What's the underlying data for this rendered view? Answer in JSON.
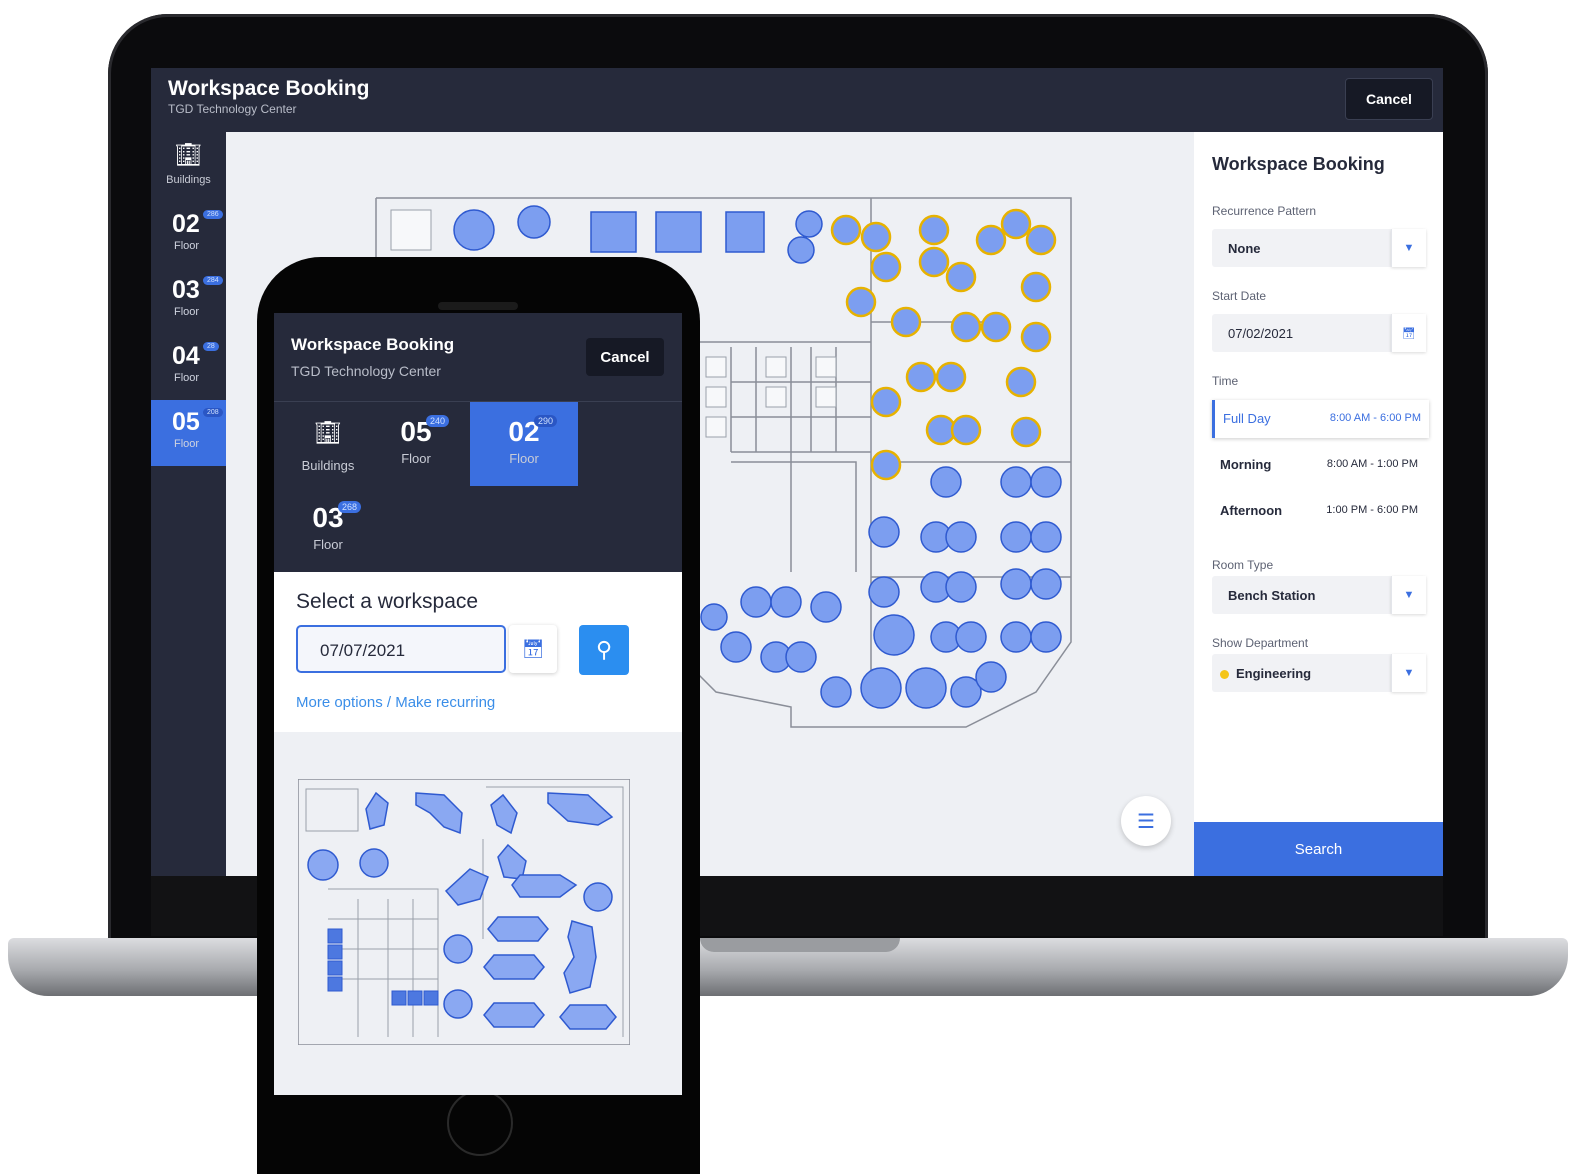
{
  "desktop": {
    "header": {
      "title": "Workspace Booking",
      "subtitle": "TGD Technology Center",
      "cancel_label": "Cancel"
    },
    "sidebar": {
      "buildings_label": "Buildings",
      "floors": [
        {
          "number": "02",
          "label": "Floor",
          "count": "286",
          "active": false
        },
        {
          "number": "03",
          "label": "Floor",
          "count": "284",
          "active": false
        },
        {
          "number": "04",
          "label": "Floor",
          "count": "28",
          "active": false
        },
        {
          "number": "05",
          "label": "Floor",
          "count": "208",
          "active": true
        }
      ]
    },
    "panel": {
      "title": "Workspace Booking",
      "recurrence_label": "Recurrence Pattern",
      "recurrence_value": "None",
      "start_date_label": "Start Date",
      "start_date_value": "07/02/2021",
      "time_label": "Time",
      "time_options": [
        {
          "name": "Full Day",
          "range": "8:00 AM - 6:00 PM",
          "selected": true
        },
        {
          "name": "Morning",
          "range": "8:00 AM - 1:00 PM",
          "selected": false
        },
        {
          "name": "Afternoon",
          "range": "1:00 PM - 6:00 PM",
          "selected": false
        }
      ],
      "room_type_label": "Room Type",
      "room_type_value": "Bench Station",
      "department_label": "Show Department",
      "department_value": "Engineering",
      "search_label": "Search"
    },
    "colors": {
      "accent": "#3b6fe0",
      "header": "#262a3b",
      "highlight": "#f5c518"
    }
  },
  "mobile": {
    "header": {
      "title": "Workspace Booking",
      "subtitle": "TGD Technology Center",
      "cancel_label": "Cancel"
    },
    "floors": {
      "buildings_label": "Buildings",
      "tiles": [
        {
          "number": "05",
          "label": "Floor",
          "count": "240",
          "active": false
        },
        {
          "number": "02",
          "label": "Floor",
          "count": "290",
          "active": true
        },
        {
          "number": "03",
          "label": "Floor",
          "count": "268",
          "active": false
        }
      ]
    },
    "select": {
      "title": "Select a workspace",
      "date_value": "07/07/2021",
      "more_options": "More options / Make recurring"
    }
  }
}
